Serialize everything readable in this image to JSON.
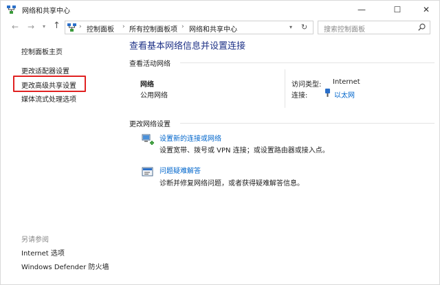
{
  "window": {
    "title": "网络和共享中心",
    "controls": {
      "minimize": "—",
      "maximize": "☐",
      "close": "✕"
    }
  },
  "nav": {
    "back": "←",
    "forward": "→",
    "recent": "▾",
    "up": "↑",
    "breadcrumbs": [
      "控制面板",
      "所有控制面板项",
      "网络和共享中心"
    ],
    "separator": "›",
    "dropdown": "▾",
    "refresh": "↻",
    "search_placeholder": "搜索控制面板"
  },
  "sidebar": {
    "items": [
      {
        "label": "控制面板主页"
      },
      {
        "label": "更改适配器设置"
      },
      {
        "label": "更改高级共享设置"
      },
      {
        "label": "媒体流式处理选项"
      }
    ],
    "see_also_label": "另请参阅",
    "see_also": [
      {
        "label": "Internet 选项"
      },
      {
        "label": "Windows Defender 防火墙"
      }
    ]
  },
  "main": {
    "title": "查看基本网络信息并设置连接",
    "active_networks_label": "查看活动网络",
    "network": {
      "name": "网络",
      "type": "公用网络",
      "access_type_label": "访问类型:",
      "access_type_value": "Internet",
      "connections_label": "连接:",
      "connection_name": "以太网"
    },
    "change_settings_label": "更改网络设置",
    "tasks": [
      {
        "link": "设置新的连接或网络",
        "desc": "设置宽带、拨号或 VPN 连接；或设置路由器或接入点。"
      },
      {
        "link": "问题疑难解答",
        "desc": "诊断并修复网络问题，或者获得疑难解答信息。"
      }
    ]
  },
  "colors": {
    "title_blue": "#1e3287",
    "link_blue": "#0066cc",
    "highlight_red": "#e02020"
  }
}
